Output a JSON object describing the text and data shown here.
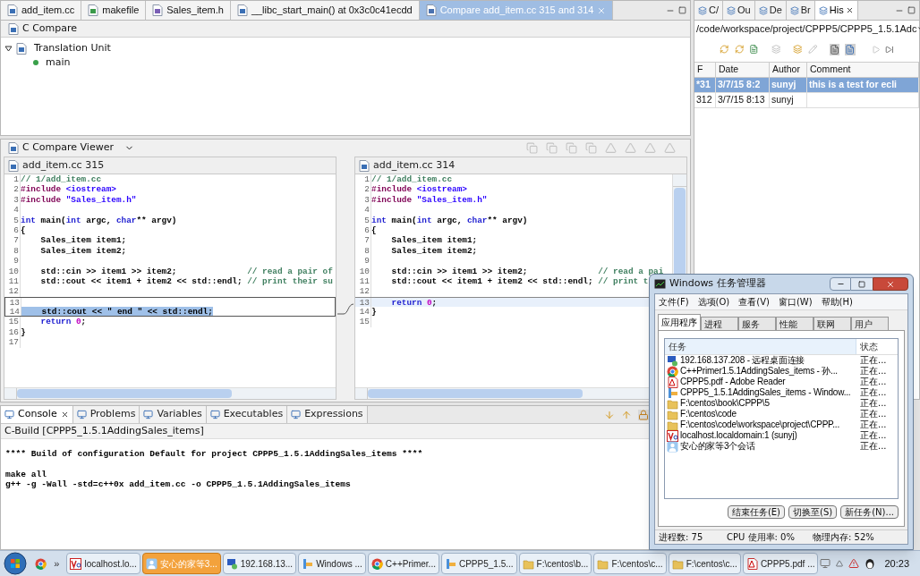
{
  "editor_tabs": [
    {
      "label": "add_item.cc",
      "selected": false
    },
    {
      "label": "makefile",
      "selected": false
    },
    {
      "label": "Sales_item.h",
      "selected": false
    },
    {
      "label": "__libc_start_main() at 0x3c0c41ecdd",
      "selected": false
    },
    {
      "label": "Compare add_item.cc 315 and 314",
      "selected": true
    }
  ],
  "structure_pane": {
    "title": "C Compare",
    "tree": [
      {
        "label": "Translation Unit",
        "expanded": true,
        "children": [
          {
            "label": "main"
          }
        ]
      }
    ]
  },
  "compare_viewer": {
    "title": "C Compare Viewer",
    "left": {
      "title": "add_item.cc 315",
      "lines": [
        {
          "num": "1",
          "changed": false,
          "selected": false,
          "tokens": [
            {
              "kind": "comment",
              "text": "// 1/add_item.cc"
            }
          ]
        },
        {
          "num": "2",
          "changed": false,
          "selected": false,
          "tokens": [
            {
              "kind": "preproc",
              "text": "#include "
            },
            {
              "kind": "string",
              "text": "<iostream>"
            }
          ]
        },
        {
          "num": "3",
          "changed": false,
          "selected": false,
          "tokens": [
            {
              "kind": "preproc",
              "text": "#include "
            },
            {
              "kind": "string",
              "text": "\"Sales_item.h\""
            }
          ]
        },
        {
          "num": "4",
          "changed": false,
          "selected": false
        },
        {
          "num": "5",
          "changed": false,
          "selected": false,
          "tokens": [
            {
              "kind": "keyword",
              "text": "int"
            },
            {
              "kind": "plain",
              "text": " main("
            },
            {
              "kind": "keyword",
              "text": "int"
            },
            {
              "kind": "plain",
              "text": " argc, "
            },
            {
              "kind": "keyword",
              "text": "char"
            },
            {
              "kind": "plain",
              "text": "** argv)"
            }
          ]
        },
        {
          "num": "6",
          "changed": false,
          "selected": false,
          "tokens": [
            {
              "kind": "plain",
              "text": "{"
            }
          ]
        },
        {
          "num": "7",
          "changed": false,
          "selected": false,
          "tokens": [
            {
              "kind": "plain",
              "text": "    Sales_item item1;"
            }
          ]
        },
        {
          "num": "8",
          "changed": false,
          "selected": false,
          "tokens": [
            {
              "kind": "plain",
              "text": "    Sales_item item2;"
            }
          ]
        },
        {
          "num": "9",
          "changed": false,
          "selected": false
        },
        {
          "num": "10",
          "changed": false,
          "selected": false,
          "tokens": [
            {
              "kind": "plain",
              "text": "    std::cin >> item1 >> item2;              "
            },
            {
              "kind": "comment",
              "text": "// read a pair of"
            }
          ]
        },
        {
          "num": "11",
          "changed": false,
          "selected": false,
          "tokens": [
            {
              "kind": "plain",
              "text": "    std::cout << item1 + item2 << std::endl; "
            },
            {
              "kind": "comment",
              "text": "// print their su"
            }
          ]
        },
        {
          "num": "12",
          "changed": false,
          "selected": false
        },
        {
          "num": "13",
          "changed": true,
          "selected": false
        },
        {
          "num": "14",
          "changed": true,
          "selected": true,
          "tokens": [
            {
              "kind": "plain",
              "text": "    std::cout << \" end \" << std::endl;"
            }
          ]
        },
        {
          "num": "15",
          "changed": false,
          "selected": false,
          "tokens": [
            {
              "kind": "keyword",
              "text": "    return"
            },
            {
              "kind": "number",
              "text": " 0"
            },
            {
              "kind": "plain",
              "text": ";"
            }
          ]
        },
        {
          "num": "16",
          "changed": false,
          "selected": false,
          "tokens": [
            {
              "kind": "plain",
              "text": "}"
            }
          ]
        },
        {
          "num": "17",
          "changed": false,
          "selected": false
        }
      ]
    },
    "right": {
      "title": "add_item.cc 314",
      "lines": [
        {
          "num": "1",
          "changed": false,
          "selected": false,
          "tokens": [
            {
              "kind": "comment",
              "text": "// 1/add_item.cc"
            }
          ]
        },
        {
          "num": "2",
          "changed": false,
          "selected": false,
          "tokens": [
            {
              "kind": "preproc",
              "text": "#include "
            },
            {
              "kind": "string",
              "text": "<iostream>"
            }
          ]
        },
        {
          "num": "3",
          "changed": false,
          "selected": false,
          "tokens": [
            {
              "kind": "preproc",
              "text": "#include "
            },
            {
              "kind": "string",
              "text": "\"Sales_item.h\""
            }
          ]
        },
        {
          "num": "4",
          "changed": false,
          "selected": false
        },
        {
          "num": "5",
          "changed": false,
          "selected": false,
          "tokens": [
            {
              "kind": "keyword",
              "text": "int"
            },
            {
              "kind": "plain",
              "text": " main("
            },
            {
              "kind": "keyword",
              "text": "int"
            },
            {
              "kind": "plain",
              "text": " argc, "
            },
            {
              "kind": "keyword",
              "text": "char"
            },
            {
              "kind": "plain",
              "text": "** argv)"
            }
          ]
        },
        {
          "num": "6",
          "changed": false,
          "selected": false,
          "tokens": [
            {
              "kind": "plain",
              "text": "{"
            }
          ]
        },
        {
          "num": "7",
          "changed": false,
          "selected": false,
          "tokens": [
            {
              "kind": "plain",
              "text": "    Sales_item item1;"
            }
          ]
        },
        {
          "num": "8",
          "changed": false,
          "selected": false,
          "tokens": [
            {
              "kind": "plain",
              "text": "    Sales_item item2;"
            }
          ]
        },
        {
          "num": "9",
          "changed": false,
          "selected": false
        },
        {
          "num": "10",
          "changed": false,
          "selected": false,
          "tokens": [
            {
              "kind": "plain",
              "text": "    std::cin >> item1 >> item2;              "
            },
            {
              "kind": "comment",
              "text": "// read a pai"
            }
          ]
        },
        {
          "num": "11",
          "changed": false,
          "selected": false,
          "tokens": [
            {
              "kind": "plain",
              "text": "    std::cout << item1 + item2 << std::endl; "
            },
            {
              "kind": "comment",
              "text": "// print t"
            }
          ]
        },
        {
          "num": "12",
          "changed": false,
          "selected": false
        },
        {
          "num": "13",
          "changed": true,
          "selected": true,
          "tokens": [
            {
              "kind": "keyword",
              "text": "    return"
            },
            {
              "kind": "number",
              "text": " 0"
            },
            {
              "kind": "plain",
              "text": ";"
            }
          ]
        },
        {
          "num": "14",
          "changed": false,
          "selected": false,
          "tokens": [
            {
              "kind": "plain",
              "text": "}"
            }
          ]
        },
        {
          "num": "15",
          "changed": false,
          "selected": false
        }
      ]
    }
  },
  "console": {
    "tabs": [
      {
        "label": "Console",
        "selected": true
      },
      {
        "label": "Problems",
        "selected": false
      },
      {
        "label": "Variables",
        "selected": false
      },
      {
        "label": "Executables",
        "selected": false
      },
      {
        "label": "Expressions",
        "selected": false
      }
    ],
    "name": "C-Build [CPPP5_1.5.1AddingSales_items]",
    "blocks": [
      [
        "**** Build of configuration Default for project CPPP5_1.5.1AddingSales_items ****"
      ],
      [
        "make all",
        "g++ -g -Wall -std=c++0x add_item.cc -o CPPP5_1.5.1AddingSales_items"
      ]
    ]
  },
  "history_view": {
    "tabs": [
      {
        "label": "C/",
        "selected": false
      },
      {
        "label": "Ou",
        "selected": false
      },
      {
        "label": "De",
        "selected": false
      },
      {
        "label": "Br",
        "selected": false
      },
      {
        "label": "His",
        "selected": true
      }
    ],
    "path": "/code/workspace/project/CPPP5/CPPP5_1.5.1Adc",
    "columns": [
      "F",
      "Date",
      "Author",
      "Comment"
    ],
    "rows": [
      {
        "cells": [
          "*31",
          "3/7/15 8:2",
          "sunyj",
          "this is a test for ecli"
        ],
        "selected": true
      },
      {
        "cells": [
          "312",
          "3/7/15 8:13",
          "sunyj"
        ],
        "selected": false
      }
    ]
  },
  "task_manager": {
    "title": "Windows 任务管理器",
    "menu": [
      "文件(F)",
      "选项(O)",
      "查看(V)",
      "窗口(W)",
      "帮助(H)"
    ],
    "tabs": [
      {
        "label": "应用程序",
        "selected": true
      },
      {
        "label": "进程",
        "selected": false
      },
      {
        "label": "服务",
        "selected": false
      },
      {
        "label": "性能",
        "selected": false
      },
      {
        "label": "联网",
        "selected": false
      },
      {
        "label": "用户",
        "selected": false
      }
    ],
    "columns": [
      "任务",
      "状态"
    ],
    "tasks": [
      {
        "kind": "remote",
        "name": "192.168.137.208 - 远程桌面连接",
        "status": "正在..."
      },
      {
        "kind": "chrome",
        "name": "C++Primer1.5.1AddingSales_items - 孙...",
        "status": "正在..."
      },
      {
        "kind": "pdf",
        "name": "CPPP5.pdf - Adobe Reader",
        "status": "正在..."
      },
      {
        "kind": "app",
        "name": "CPPP5_1.5.1AddingSales_items - Window...",
        "status": "正在..."
      },
      {
        "kind": "folder",
        "name": "F:\\centos\\book\\CPPP\\5",
        "status": "正在..."
      },
      {
        "kind": "folder",
        "name": "F:\\centos\\code",
        "status": "正在..."
      },
      {
        "kind": "folder",
        "name": "F:\\centos\\code\\workspace\\project\\CPPP...",
        "status": "正在..."
      },
      {
        "kind": "vnc",
        "name": "localhost.localdomain:1 (sunyj)",
        "status": "正在..."
      },
      {
        "kind": "chat",
        "name": "安心的家等3个会话",
        "status": "正在..."
      }
    ],
    "buttons": [
      "结束任务(E)",
      "切换至(S)",
      "新任务(N)..."
    ],
    "status": [
      "进程数: 75",
      "CPU 使用率: 0%",
      "物理内存: 52%"
    ]
  },
  "taskbar": {
    "items": [
      {
        "kind": "vnc",
        "label": "localhost.lo...",
        "highlighted": false
      },
      {
        "kind": "chat",
        "label": "安心的家等3...",
        "highlighted": true
      },
      {
        "kind": "remote",
        "label": "192.168.13...",
        "highlighted": false
      },
      {
        "kind": "app",
        "label": "Windows ...",
        "highlighted": false
      },
      {
        "kind": "chrome",
        "label": "C++Primer...",
        "highlighted": false
      },
      {
        "kind": "app",
        "label": "CPPP5_1.5...",
        "highlighted": false
      },
      {
        "kind": "folder",
        "label": "F:\\centos\\b...",
        "highlighted": false
      },
      {
        "kind": "folder",
        "label": "F:\\centos\\c...",
        "highlighted": false
      },
      {
        "kind": "folder",
        "label": "F:\\centos\\c...",
        "highlighted": false
      },
      {
        "kind": "pdf",
        "label": "CPPP5.pdf ...",
        "highlighted": false
      }
    ],
    "overflow": "»",
    "clock": "20:23"
  }
}
